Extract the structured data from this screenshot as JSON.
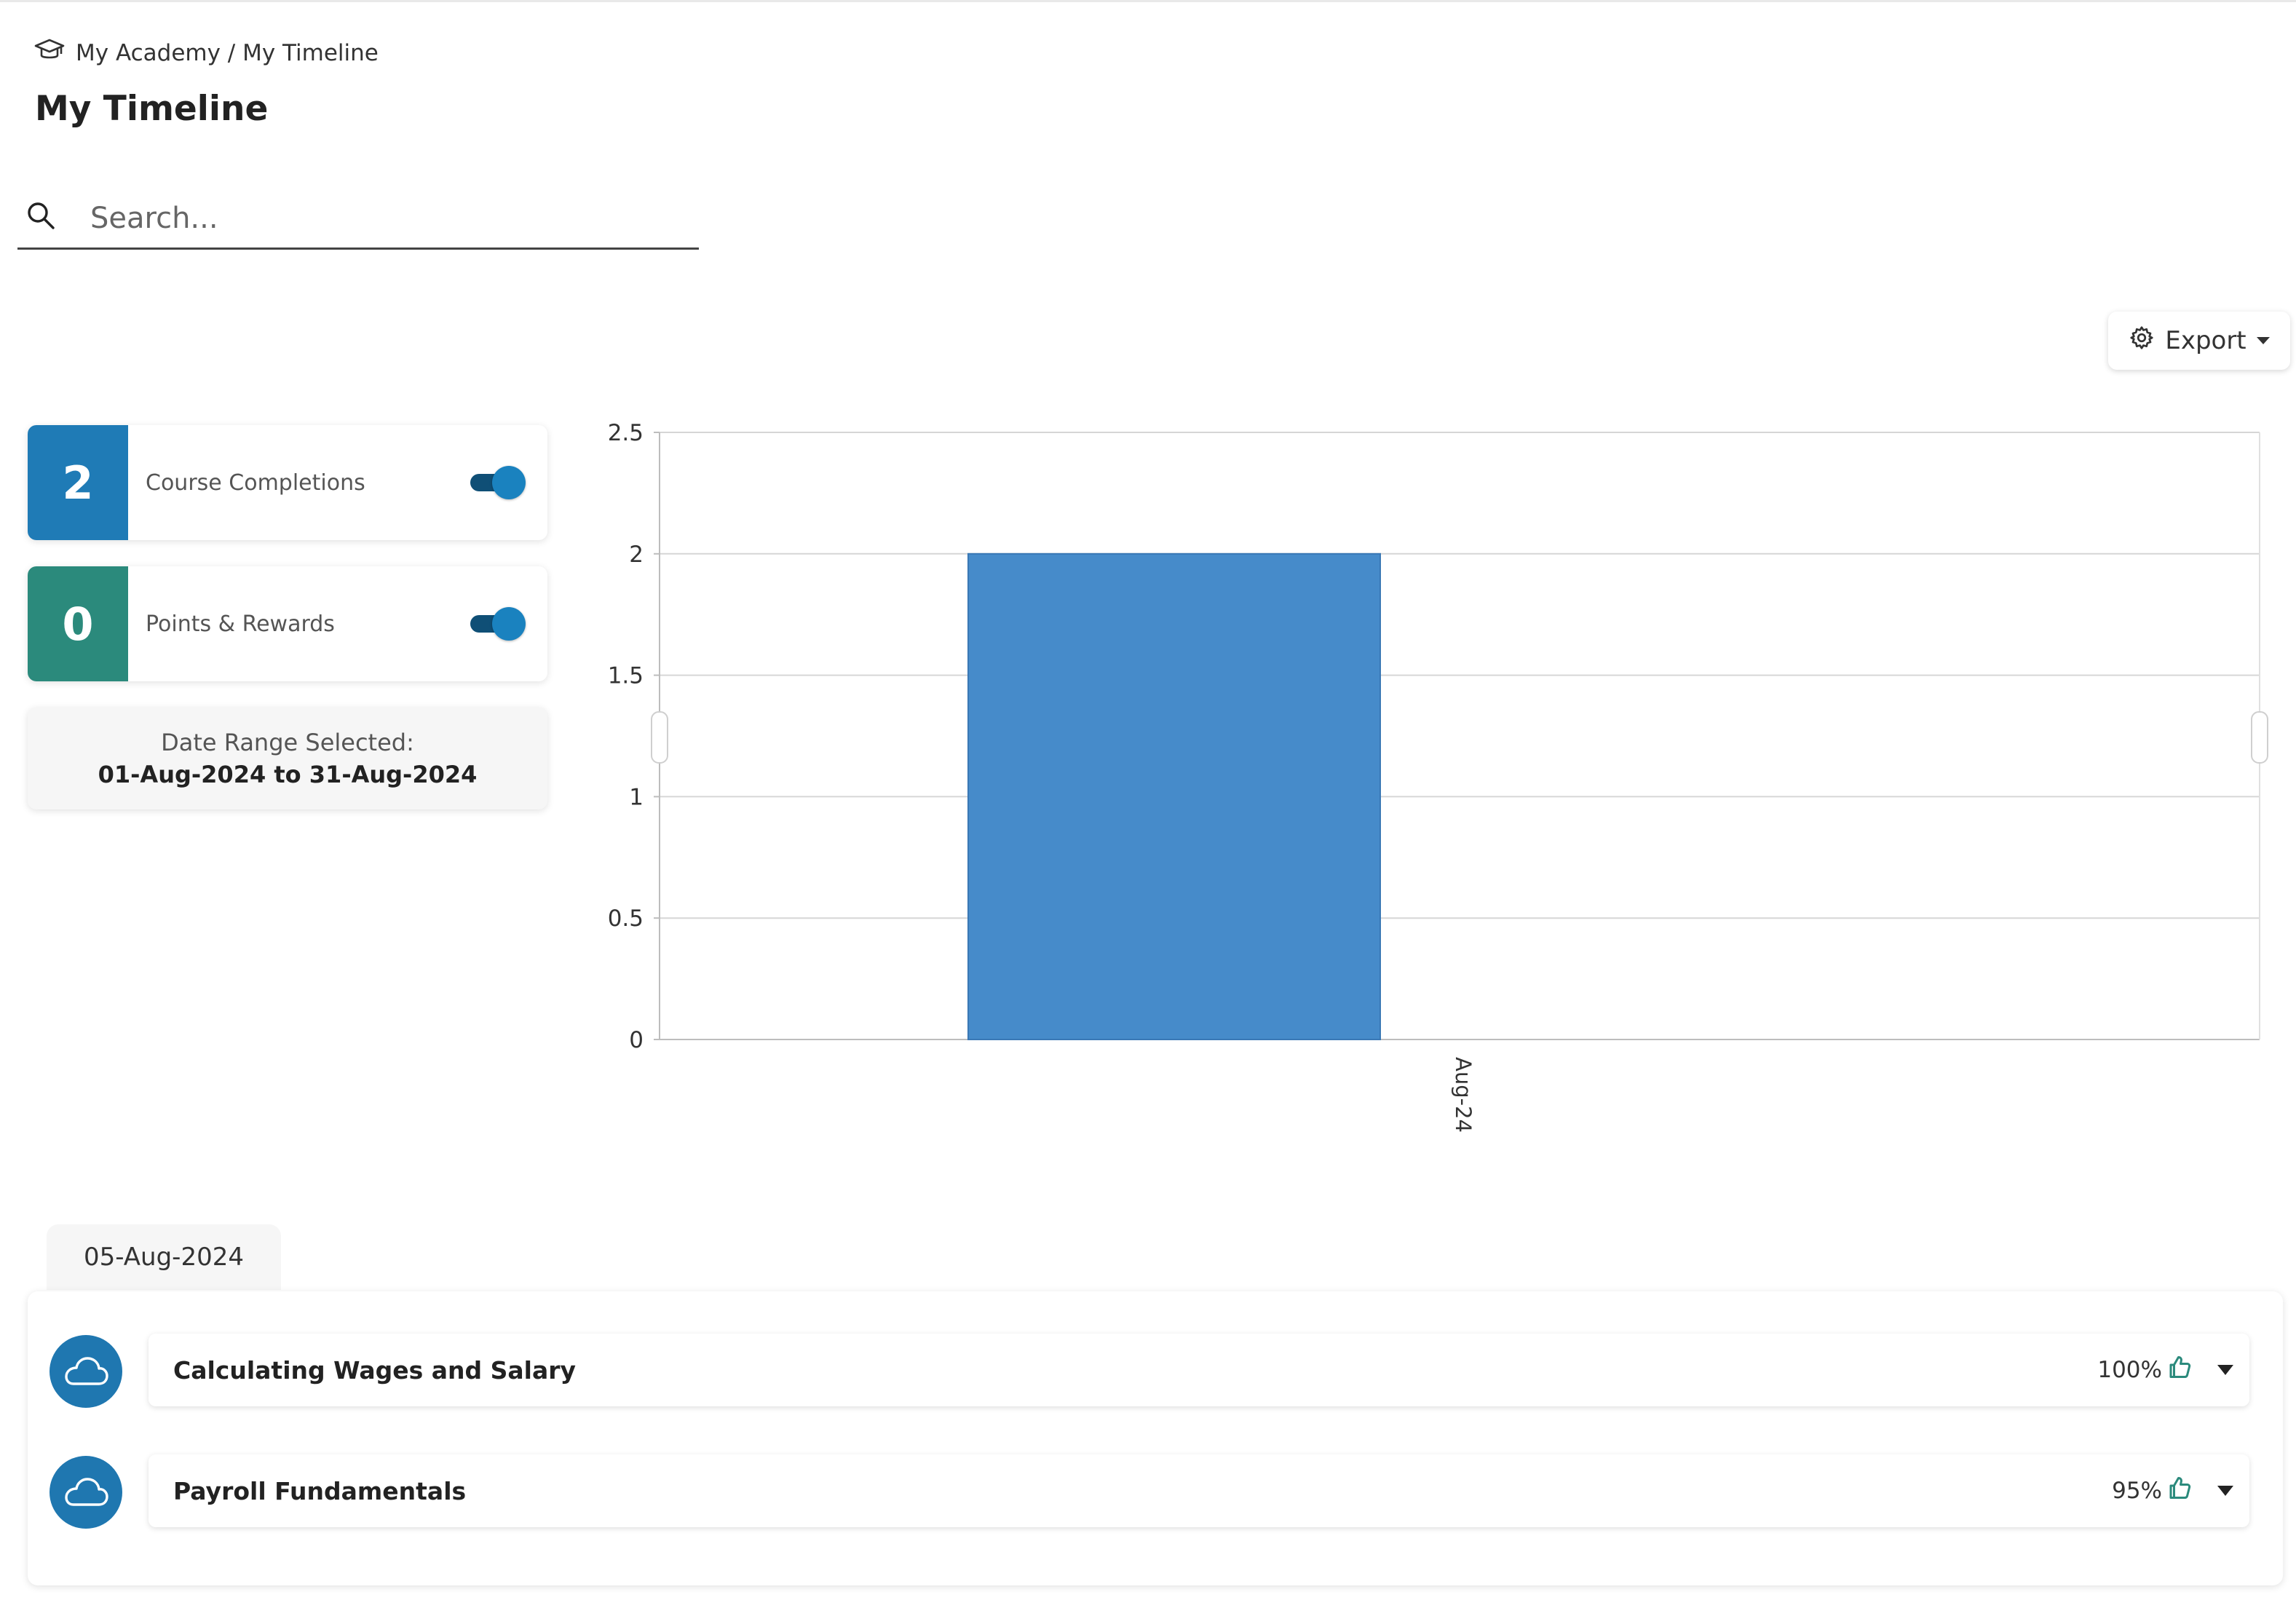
{
  "breadcrumb": {
    "icon": "graduation-cap-icon",
    "text": "My Academy / My Timeline"
  },
  "page_title": "My Timeline",
  "search": {
    "placeholder": "Search...",
    "value": "",
    "icon": "search-icon"
  },
  "export": {
    "label": "Export",
    "icon": "gear-icon"
  },
  "stats": [
    {
      "value": "2",
      "label": "Course Completions",
      "color": "#1f7bb6",
      "toggle_on": true
    },
    {
      "value": "0",
      "label": "Points & Rewards",
      "color": "#2b8a7c",
      "toggle_on": true
    }
  ],
  "date_range": {
    "heading": "Date Range Selected:",
    "range": "01-Aug-2024 to 31-Aug-2024"
  },
  "chart_data": {
    "type": "bar",
    "categories": [
      "Aug-24"
    ],
    "values": [
      2
    ],
    "ylim": [
      0,
      2.5
    ],
    "yticks": [
      "0",
      "0.5",
      "1",
      "1.5",
      "2",
      "2.5"
    ],
    "grid": true,
    "bar_color": "#468bca",
    "title": "",
    "xlabel": "",
    "ylabel": ""
  },
  "timeline": {
    "date": "05-Aug-2024",
    "items": [
      {
        "title": "Calculating Wages and Salary",
        "score": "100%",
        "icon": "cloud-icon"
      },
      {
        "title": "Payroll Fundamentals",
        "score": "95%",
        "icon": "cloud-icon"
      }
    ]
  },
  "colors": {
    "accent": "#1f77b0",
    "bar": "#468bca",
    "thumb": "#2b8a7c"
  }
}
